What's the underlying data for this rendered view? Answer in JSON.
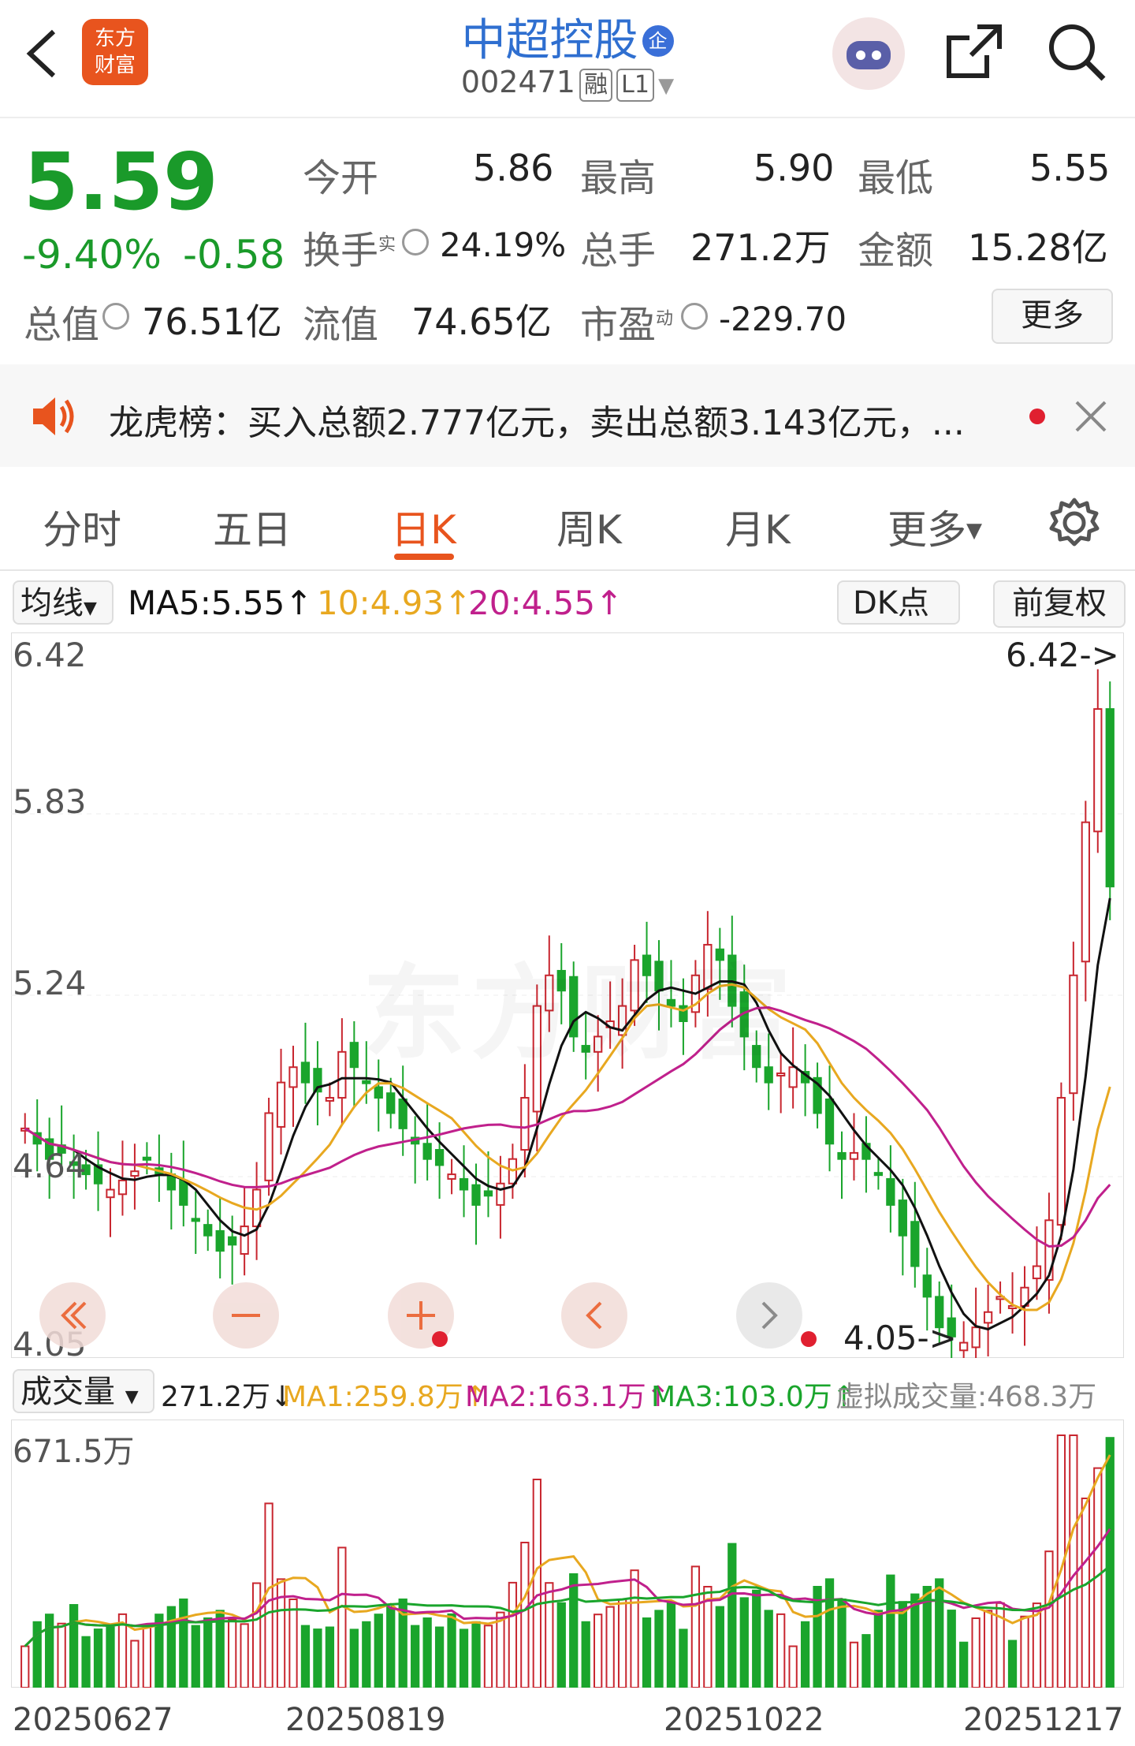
{
  "header": {
    "title": "中超控股",
    "code": "002471",
    "tags": [
      "融",
      "L1"
    ],
    "badge": "企",
    "logo_text": "东方财富"
  },
  "quote": {
    "price": "5.59",
    "change_pct": "-9.40%",
    "change": "-0.58",
    "open_label": "今开",
    "open": "5.86",
    "high_label": "最高",
    "high": "5.90",
    "low_label": "最低",
    "low": "5.55",
    "turnover_label": "换手",
    "turnover_sup": "实",
    "turnover": "24.19%",
    "volume_label": "总手",
    "volume": "271.2万",
    "amount_label": "金额",
    "amount": "15.28亿",
    "mktcap_label": "总值",
    "mktcap": "76.51亿",
    "float_label": "流值",
    "float": "74.65亿",
    "pe_label": "市盈",
    "pe_sup": "动",
    "pe": "-229.70",
    "more": "更多"
  },
  "notice": {
    "text": "龙虎榜：买入总额2.777亿元，卖出总额3.143亿元，..."
  },
  "tabs": [
    "分时",
    "五日",
    "日K",
    "周K",
    "月K",
    "更多"
  ],
  "active_tab": "日K",
  "ma_bar": {
    "selector": "均线",
    "ma5": "MA5:5.55↑",
    "ma10": "10:4.93↑",
    "ma20": "20:4.55↑",
    "dk": "DK点",
    "adjust": "前复权"
  },
  "colors": {
    "up": "#c8262f",
    "down": "#1aa52c",
    "ma5": "#111111",
    "ma10": "#e8a820",
    "ma20": "#c0208c",
    "accent": "#e8541e"
  },
  "price_axis": [
    "6.42",
    "5.83",
    "5.24",
    "4.64",
    "4.05"
  ],
  "max_label": "6.42->",
  "min_label": "4.05->",
  "watermark": "东方财富",
  "volume_bar": {
    "selector": "成交量",
    "vol": "271.2万↓",
    "ma1": "MA1:259.8万↑",
    "ma2": "MA2:163.1万↑",
    "ma3": "MA3:103.0万↑",
    "virtual": "虚拟成交量:468.3万",
    "max": "671.5万"
  },
  "dates": [
    "20250627",
    "20250819",
    "20251022",
    "20251217"
  ],
  "chart_data": {
    "type": "candlestick",
    "ylim": [
      4.05,
      6.42
    ],
    "series_closes_approx": [
      4.8,
      4.75,
      4.7,
      4.72,
      4.68,
      4.65,
      4.62,
      4.6,
      4.63,
      4.66,
      4.7,
      4.65,
      4.6,
      4.55,
      4.5,
      4.45,
      4.4,
      4.42,
      4.48,
      4.6,
      4.85,
      4.95,
      5.0,
      4.95,
      4.92,
      4.9,
      5.05,
      5.0,
      4.95,
      4.9,
      4.85,
      4.8,
      4.75,
      4.7,
      4.68,
      4.65,
      4.6,
      4.55,
      4.58,
      4.62,
      4.7,
      4.9,
      5.2,
      5.3,
      5.25,
      5.1,
      5.05,
      5.1,
      5.15,
      5.2,
      5.35,
      5.3,
      5.25,
      5.2,
      5.15,
      5.3,
      5.4,
      5.35,
      5.2,
      5.1,
      5.0,
      4.95,
      4.98,
      5.0,
      4.95,
      4.85,
      4.75,
      4.7,
      4.72,
      4.7,
      4.65,
      4.55,
      4.45,
      4.35,
      4.25,
      4.15,
      4.12,
      4.1,
      4.15,
      4.2,
      4.25,
      4.22,
      4.28,
      4.35,
      4.5,
      4.9,
      5.3,
      5.8,
      6.17,
      5.59
    ]
  }
}
